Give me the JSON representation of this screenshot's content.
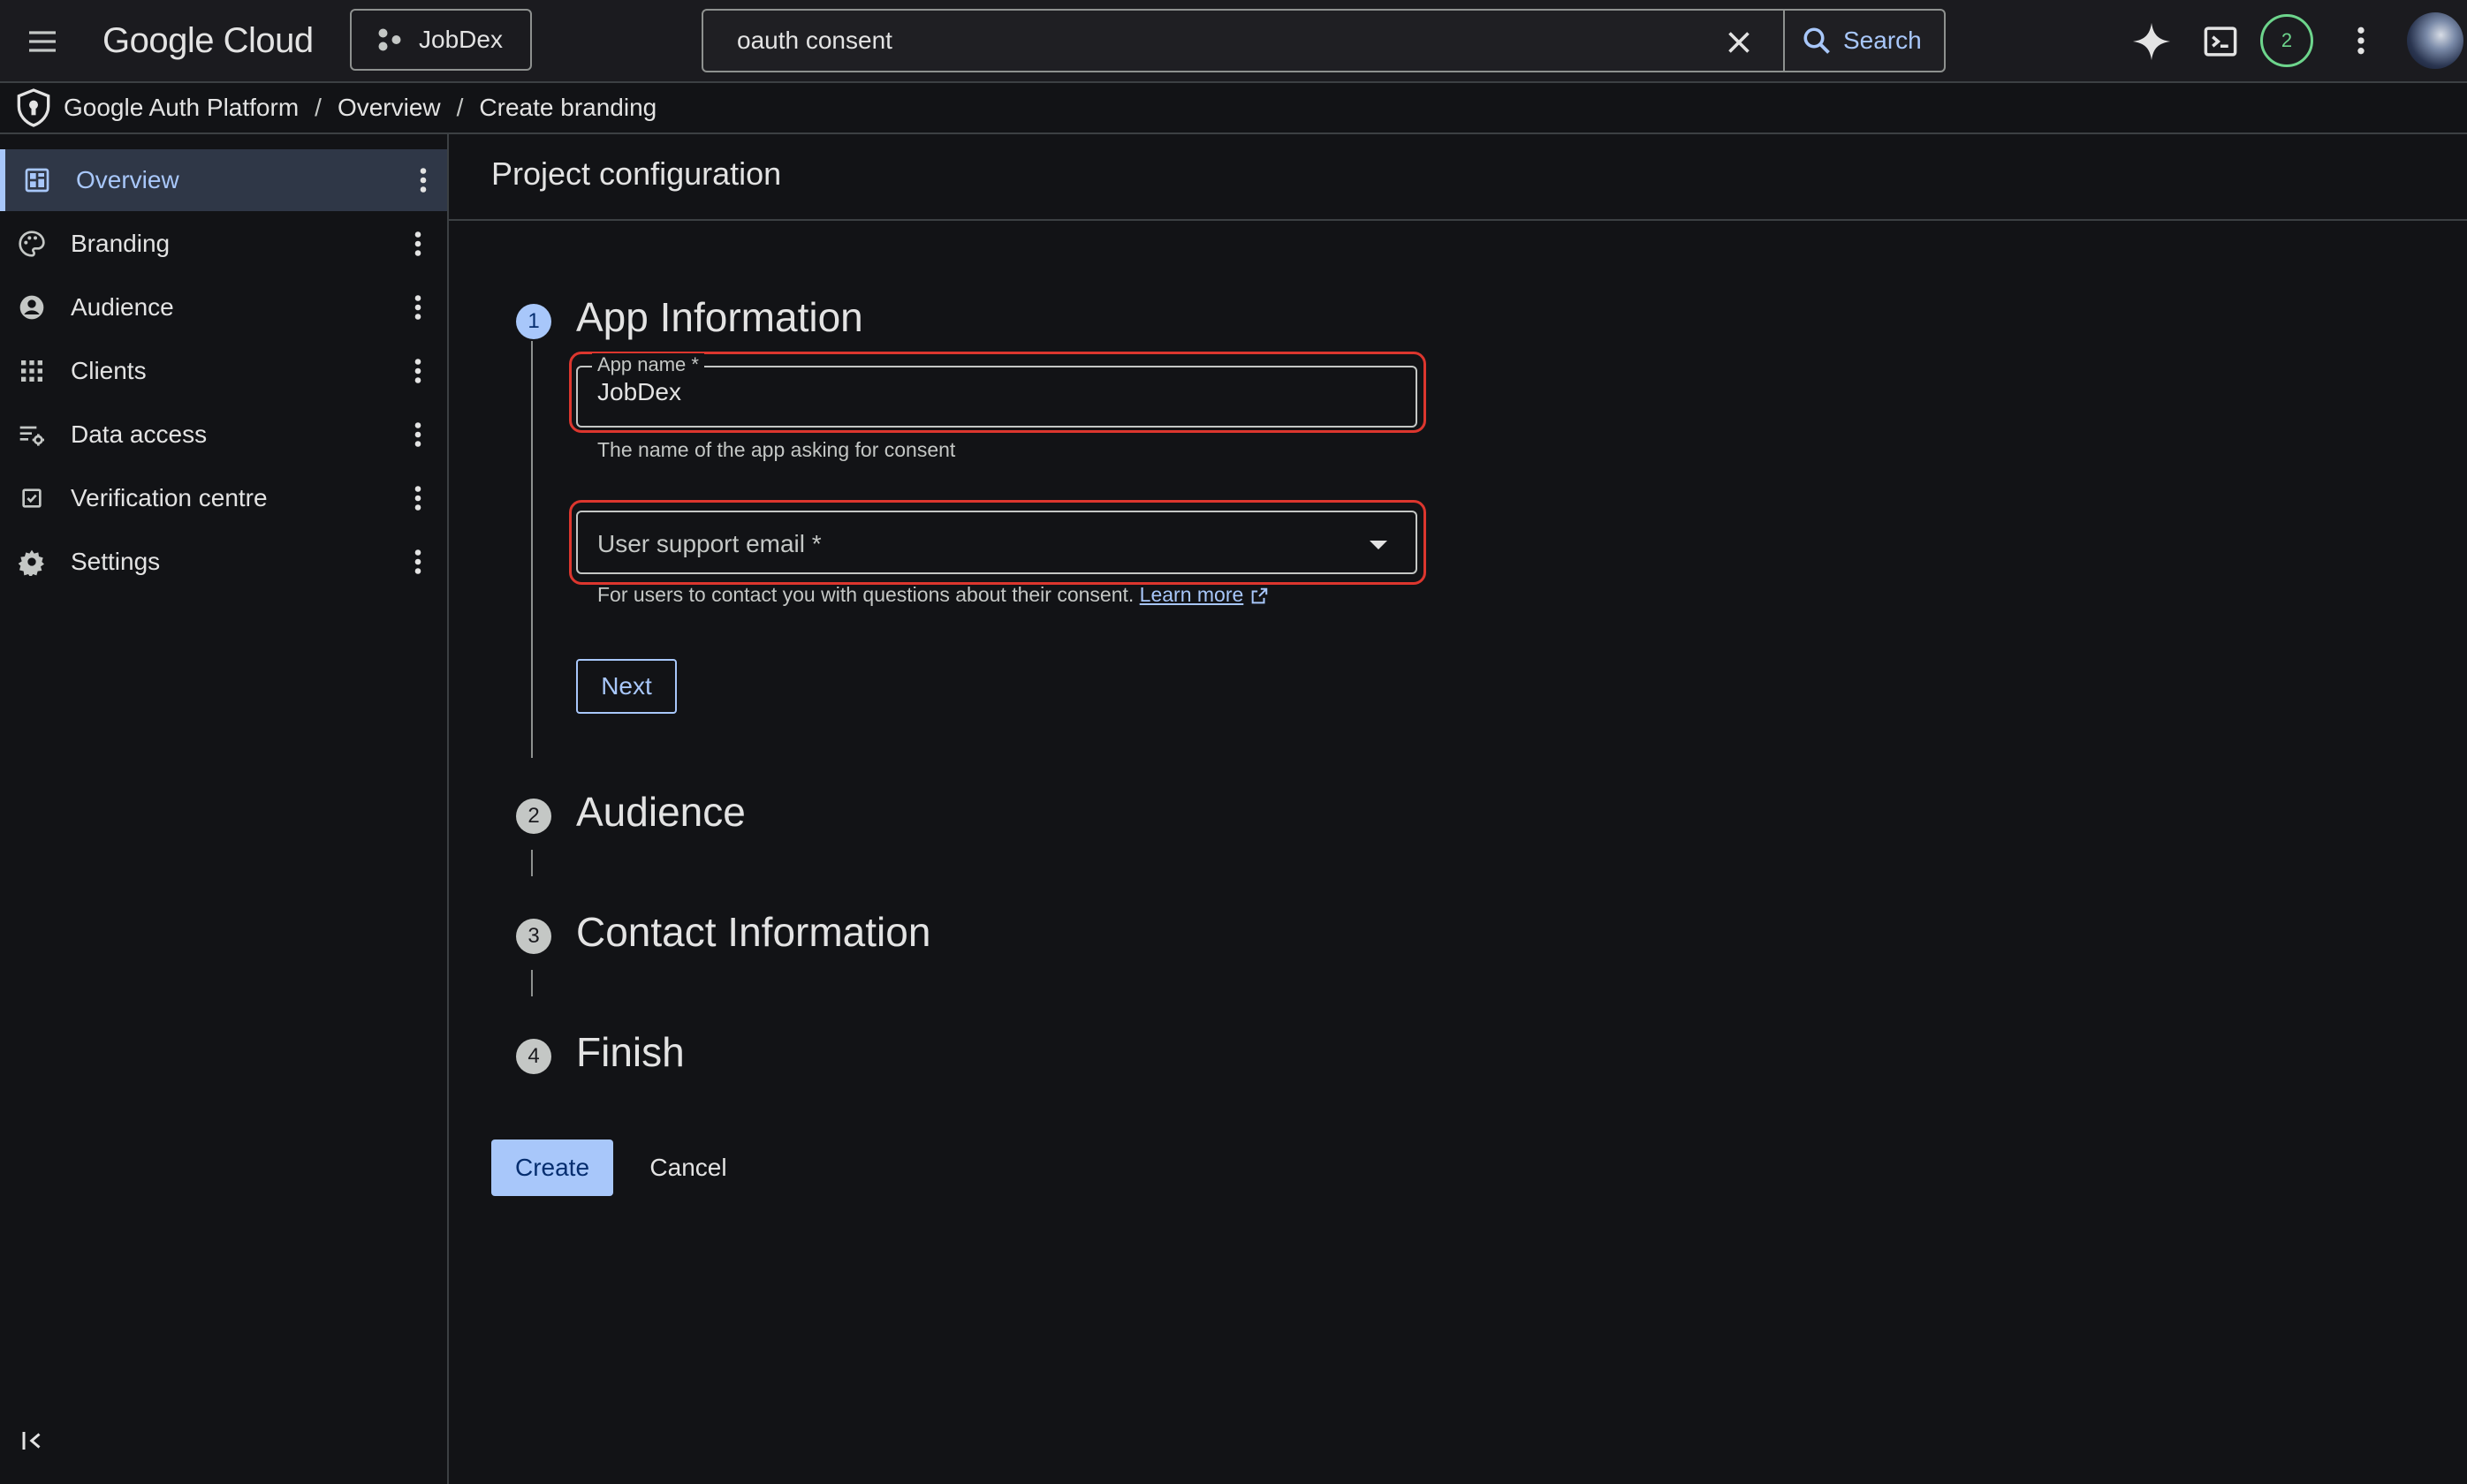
{
  "header": {
    "logo": "Google Cloud",
    "project": "JobDex",
    "search_value": "oauth consent",
    "search_button": "Search",
    "notification_count": "2"
  },
  "breadcrumb": {
    "items": [
      "Google Auth Platform",
      "Overview",
      "Create branding"
    ],
    "separator": "/"
  },
  "sidebar": {
    "items": [
      {
        "label": "Overview",
        "icon": "dashboard-icon",
        "active": true
      },
      {
        "label": "Branding",
        "icon": "palette-icon"
      },
      {
        "label": "Audience",
        "icon": "account-circle-icon"
      },
      {
        "label": "Clients",
        "icon": "apps-grid-icon"
      },
      {
        "label": "Data access",
        "icon": "data-access-icon"
      },
      {
        "label": "Verification centre",
        "icon": "checkbox-icon"
      },
      {
        "label": "Settings",
        "icon": "gear-icon"
      }
    ]
  },
  "main": {
    "title": "Project configuration",
    "steps": [
      {
        "number": "1",
        "title": "App Information",
        "state": "active"
      },
      {
        "number": "2",
        "title": "Audience",
        "state": "todo"
      },
      {
        "number": "3",
        "title": "Contact Information",
        "state": "todo"
      },
      {
        "number": "4",
        "title": "Finish",
        "state": "todo"
      }
    ],
    "app_name": {
      "label": "App name *",
      "value": "JobDex",
      "helper": "The name of the app asking for consent"
    },
    "support_email": {
      "placeholder": "User support email *",
      "helper": "For users to contact you with questions about their consent.",
      "learn_more": "Learn more"
    },
    "next_label": "Next",
    "create_label": "Create",
    "cancel_label": "Cancel"
  },
  "colors": {
    "accent": "#a8c7fa",
    "highlight_outline": "#dc362e",
    "background": "#121316"
  }
}
